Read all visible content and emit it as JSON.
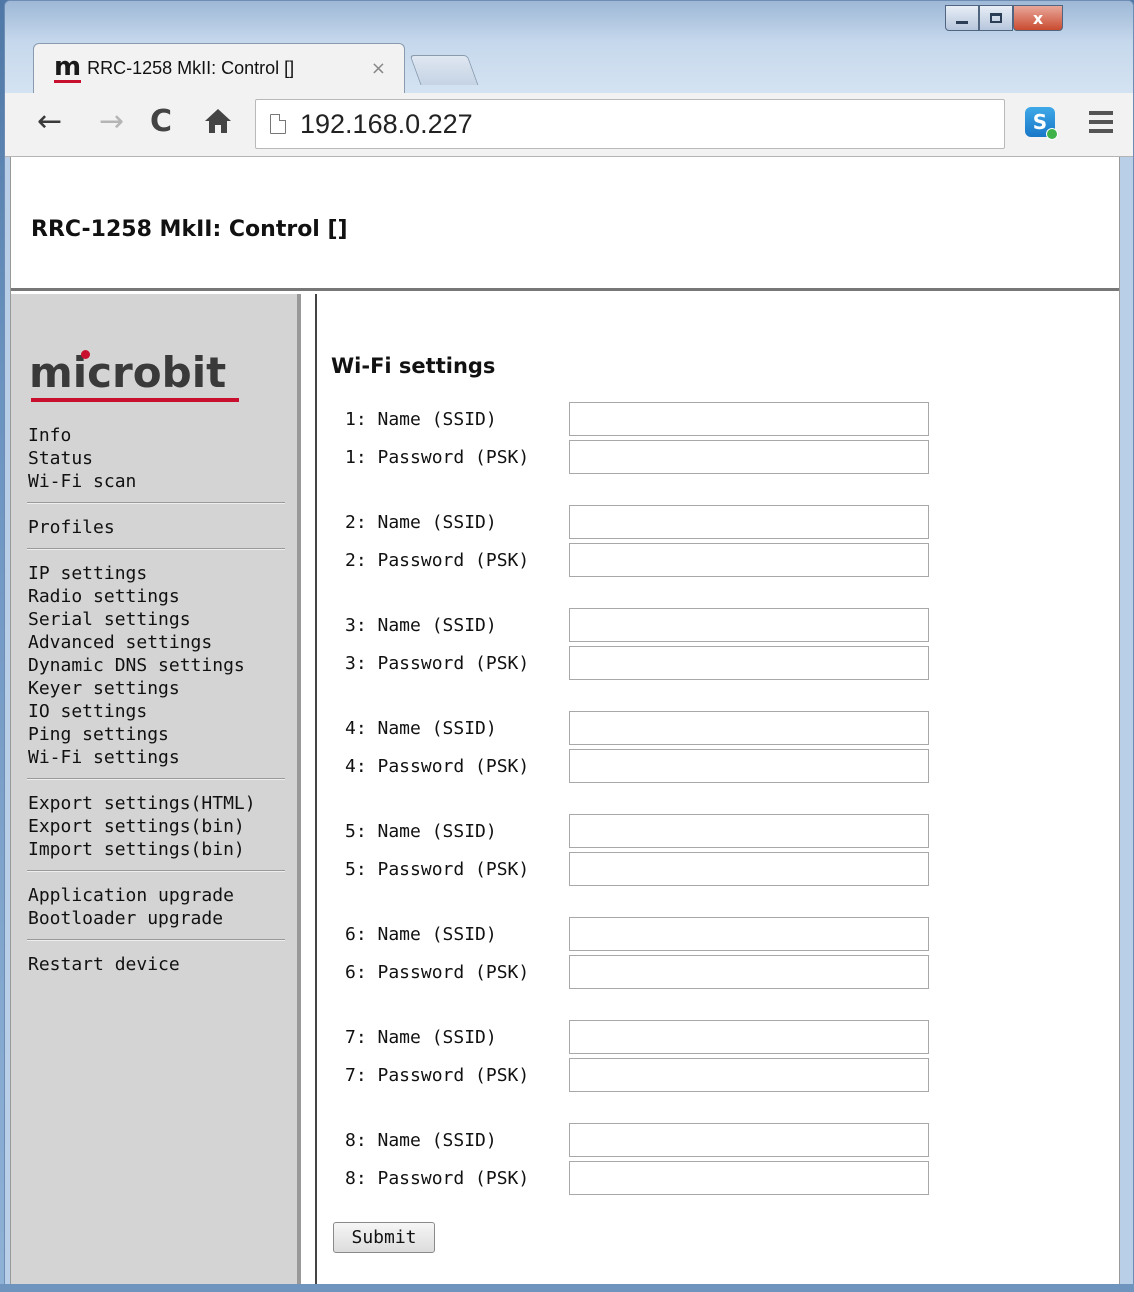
{
  "browser": {
    "tab_logo": "m",
    "tab_title": "RRC-1258 MkII: Control []",
    "tab_close": "×",
    "url": "192.168.0.227",
    "window_close": "x",
    "ext_icon": "S",
    "icons": {
      "back": "←",
      "forward": "→",
      "reload": "C",
      "home": "🏠"
    }
  },
  "header": {
    "title": "RRC-1258 MkII: Control []"
  },
  "sidebar": {
    "logo": "microbit",
    "groups": [
      [
        "Info",
        "Status",
        "Wi-Fi scan"
      ],
      [
        "Profiles"
      ],
      [
        "IP settings",
        "Radio settings",
        "Serial settings",
        "Advanced settings",
        "Dynamic DNS settings",
        "Keyer settings",
        "IO settings",
        "Ping settings",
        "Wi-Fi settings"
      ],
      [
        "Export settings(HTML)",
        "Export settings(bin)",
        "Import settings(bin)"
      ],
      [
        "Application upgrade",
        "Bootloader upgrade"
      ],
      [
        "Restart device"
      ]
    ]
  },
  "content": {
    "title": "Wi-Fi settings",
    "networks": [
      {
        "name_label": "1: Name (SSID)",
        "psk_label": "1: Password (PSK)",
        "ssid": "",
        "psk": ""
      },
      {
        "name_label": "2: Name (SSID)",
        "psk_label": "2: Password (PSK)",
        "ssid": "",
        "psk": ""
      },
      {
        "name_label": "3: Name (SSID)",
        "psk_label": "3: Password (PSK)",
        "ssid": "",
        "psk": ""
      },
      {
        "name_label": "4: Name (SSID)",
        "psk_label": "4: Password (PSK)",
        "ssid": "",
        "psk": ""
      },
      {
        "name_label": "5: Name (SSID)",
        "psk_label": "5: Password (PSK)",
        "ssid": "",
        "psk": ""
      },
      {
        "name_label": "6: Name (SSID)",
        "psk_label": "6: Password (PSK)",
        "ssid": "",
        "psk": ""
      },
      {
        "name_label": "7: Name (SSID)",
        "psk_label": "7: Password (PSK)",
        "ssid": "",
        "psk": ""
      },
      {
        "name_label": "8: Name (SSID)",
        "psk_label": "8: Password (PSK)",
        "ssid": "",
        "psk": ""
      }
    ],
    "submit_label": "Submit"
  },
  "colors": {
    "brand_red": "#c8102e",
    "sidebar_bg": "#d4d4d4"
  }
}
